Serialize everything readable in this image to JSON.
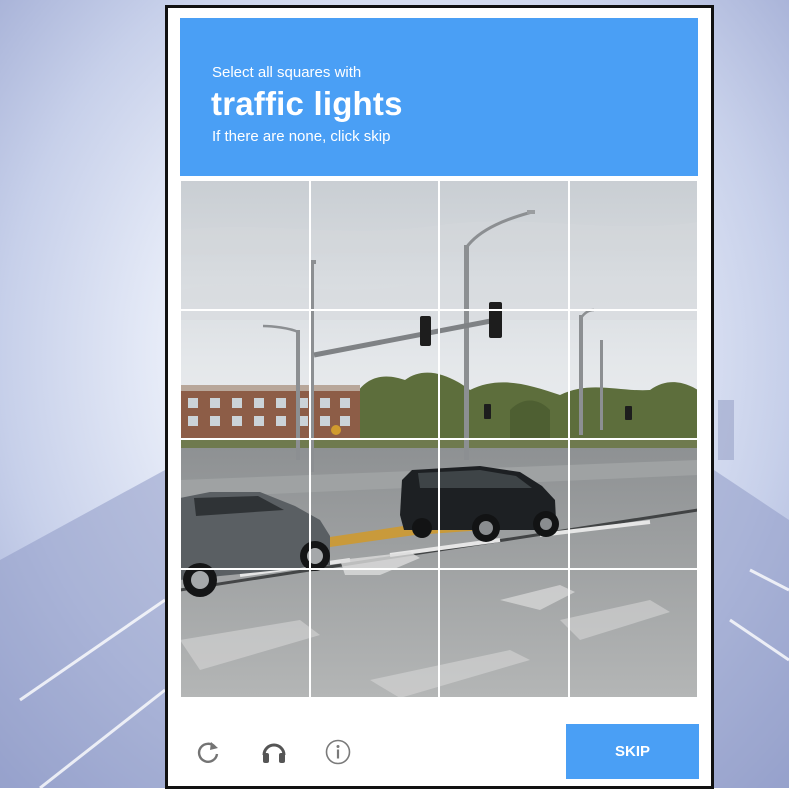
{
  "challenge": {
    "instruction": "Select all squares with",
    "keyword": "traffic lights",
    "hint": "If there are none, click skip"
  },
  "grid": {
    "rows": 4,
    "columns": 4,
    "tiles": [
      {
        "row": 1,
        "col": 1
      },
      {
        "row": 1,
        "col": 2
      },
      {
        "row": 1,
        "col": 3
      },
      {
        "row": 1,
        "col": 4
      },
      {
        "row": 2,
        "col": 1
      },
      {
        "row": 2,
        "col": 2
      },
      {
        "row": 2,
        "col": 3
      },
      {
        "row": 2,
        "col": 4
      },
      {
        "row": 3,
        "col": 1
      },
      {
        "row": 3,
        "col": 2
      },
      {
        "row": 3,
        "col": 3
      },
      {
        "row": 3,
        "col": 4
      },
      {
        "row": 4,
        "col": 1
      },
      {
        "row": 4,
        "col": 2
      },
      {
        "row": 4,
        "col": 3
      },
      {
        "row": 4,
        "col": 4
      }
    ]
  },
  "footer": {
    "icons": [
      "reload-icon",
      "audio-challenge-icon",
      "info-icon"
    ],
    "skip_label": "SKIP"
  },
  "colors": {
    "accent": "#4a9ff5",
    "frame_border": "#111111"
  }
}
